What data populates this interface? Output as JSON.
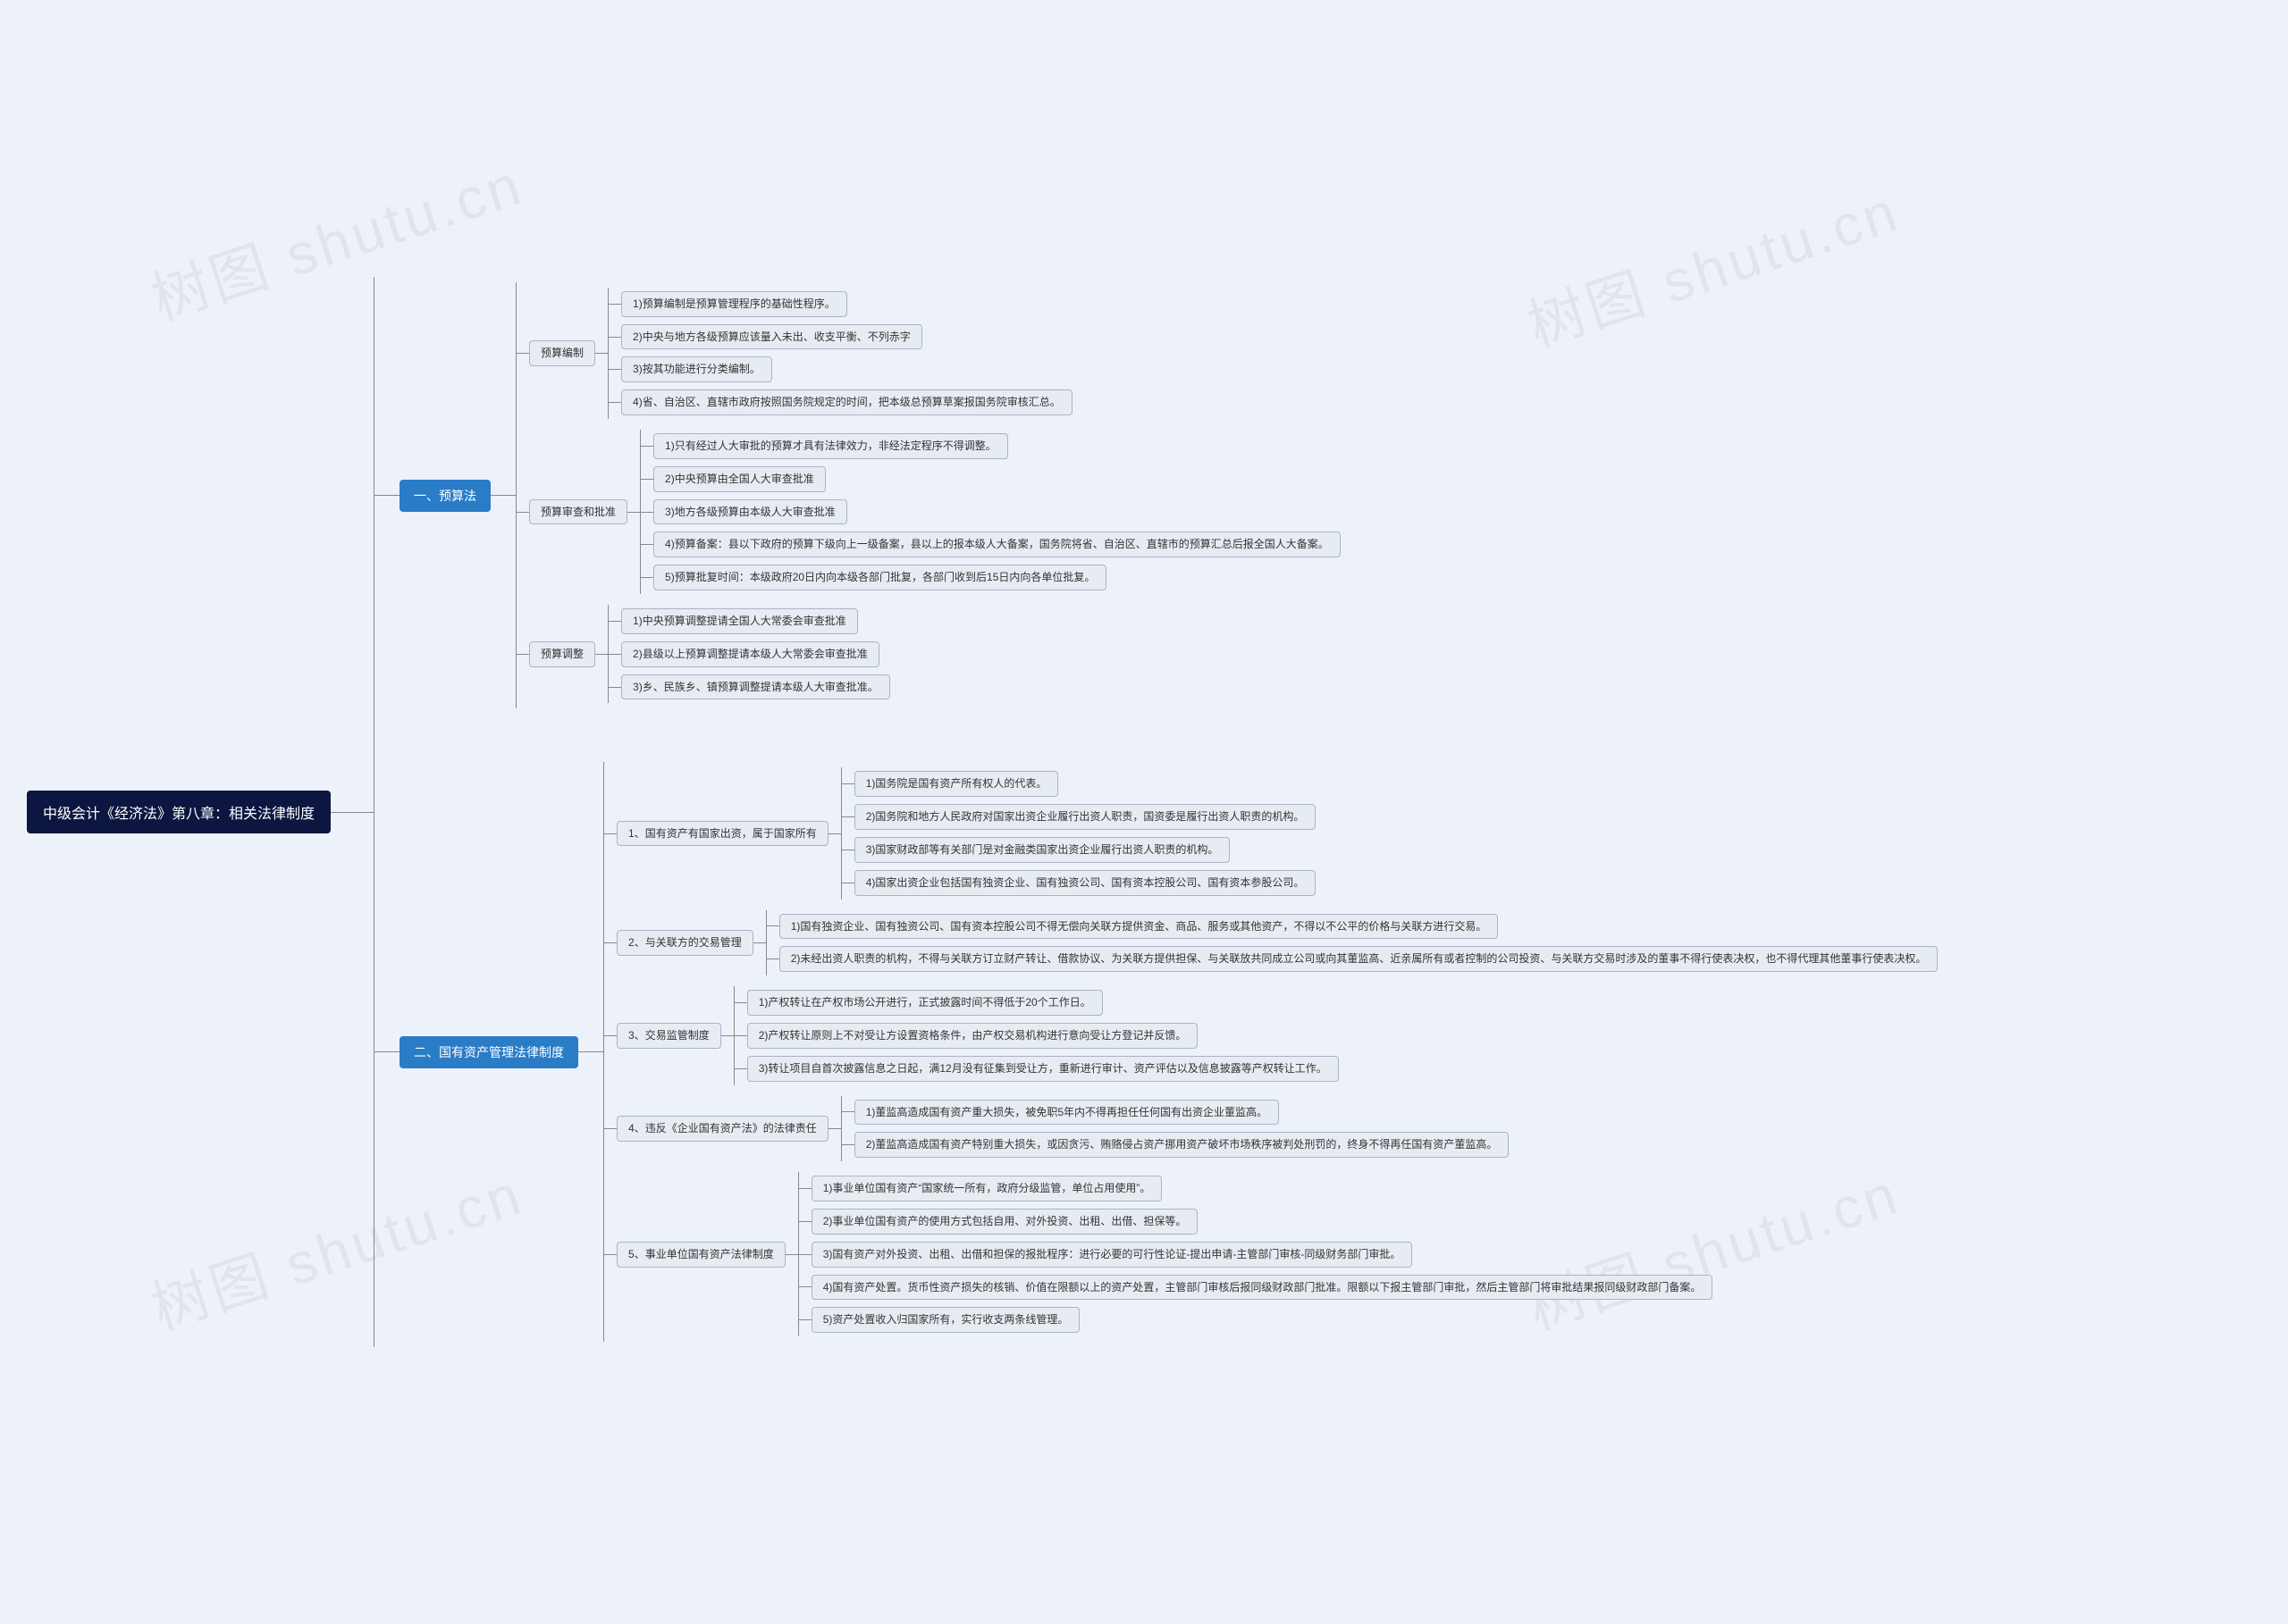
{
  "root": "中级会计《经济法》第八章：相关法律制度",
  "s1": {
    "title": "一、预算法",
    "a": {
      "title": "预算编制",
      "items": [
        "1)预算编制是预算管理程序的基础性程序。",
        "2)中央与地方各级预算应该量入未出、收支平衡、不列赤字",
        "3)按其功能进行分类编制。",
        "4)省、自治区、直辖市政府按照国务院规定的时间，把本级总预算草案报国务院审核汇总。"
      ]
    },
    "b": {
      "title": "预算审查和批准",
      "items": [
        "1)只有经过人大审批的预算才具有法律效力，非经法定程序不得调整。",
        "2)中央预算由全国人大审查批准",
        "3)地方各级预算由本级人大审查批准",
        "4)预算备案：县以下政府的预算下级向上一级备案，县以上的报本级人大备案，国务院将省、自治区、直辖市的预算汇总后报全国人大备案。",
        "5)预算批复时间：本级政府20日内向本级各部门批复，各部门收到后15日内向各单位批复。"
      ]
    },
    "c": {
      "title": "预算调整",
      "items": [
        "1)中央预算调整提请全国人大常委会审查批准",
        "2)县级以上预算调整提请本级人大常委会审查批准",
        "3)乡、民族乡、镇预算调整提请本级人大审查批准。"
      ]
    }
  },
  "s2": {
    "title": "二、国有资产管理法律制度",
    "a": {
      "title": "1、国有资产有国家出资，属于国家所有",
      "items": [
        "1)国务院是国有资产所有权人的代表。",
        "2)国务院和地方人民政府对国家出资企业履行出资人职责，国资委是履行出资人职责的机构。",
        "3)国家财政部等有关部门是对金融类国家出资企业履行出资人职责的机构。",
        "4)国家出资企业包括国有独资企业、国有独资公司、国有资本控股公司、国有资本参股公司。"
      ]
    },
    "b": {
      "title": "2、与关联方的交易管理",
      "items": [
        "1)国有独资企业、国有独资公司、国有资本控股公司不得无偿向关联方提供资金、商品、服务或其他资产，不得以不公平的价格与关联方进行交易。",
        "2)未经出资人职责的机构，不得与关联方订立财产转让、借款协议、为关联方提供担保、与关联放共同成立公司或向其董监高、近亲属所有或者控制的公司投资、与关联方交易时涉及的董事不得行使表决权，也不得代理其他董事行使表决权。"
      ]
    },
    "c": {
      "title": "3、交易监管制度",
      "items": [
        "1)产权转让在产权市场公开进行，正式披露时间不得低于20个工作日。",
        "2)产权转让原则上不对受让方设置资格条件，由产权交易机构进行意向受让方登记并反馈。",
        "3)转让项目自首次披露信息之日起，满12月没有征集到受让方，重新进行审计、资产评估以及信息披露等产权转让工作。"
      ]
    },
    "d": {
      "title": "4、违反《企业国有资产法》的法律责任",
      "items": [
        "1)董监高造成国有资产重大损失，被免职5年内不得再担任任何国有出资企业董监高。",
        "2)董监高造成国有资产特别重大损失，或因贪污、贿赂侵占资产挪用资产破坏市场秩序被判处刑罚的，终身不得再任国有资产董监高。"
      ]
    },
    "e": {
      "title": "5、事业单位国有资产法律制度",
      "items": [
        "1)事业单位国有资产“国家统一所有，政府分级监管，单位占用使用”。",
        "2)事业单位国有资产的使用方式包括自用、对外投资、出租、出借、担保等。",
        "3)国有资产对外投资、出租、出借和担保的报批程序：进行必要的可行性论证-提出申请-主管部门审核-同级财务部门审批。",
        "4)国有资产处置。货币性资产损失的核销、价值在限额以上的资产处置，主管部门审核后报同级财政部门批准。限额以下报主管部门审批，然后主管部门将审批结果报同级财政部门备案。",
        "5)资产处置收入归国家所有，实行收支两条线管理。"
      ]
    }
  },
  "watermarks": [
    "树图 shutu.cn",
    "树图 shutu.cn",
    "树图 shutu.cn",
    "树图 shutu.cn"
  ]
}
